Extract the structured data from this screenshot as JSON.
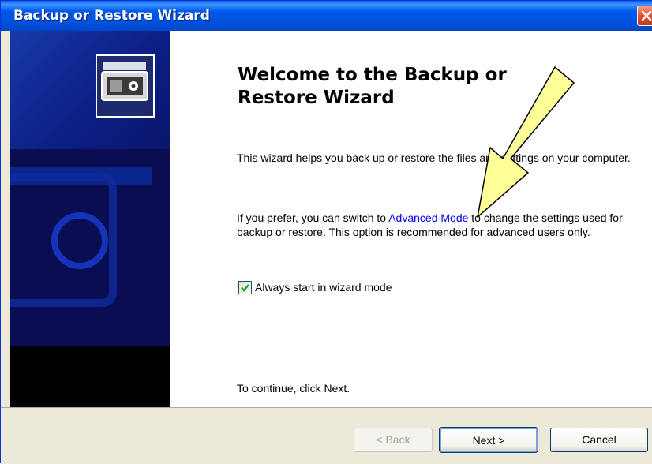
{
  "window": {
    "title": "Backup or Restore Wizard"
  },
  "content": {
    "heading": "Welcome to the Backup or Restore Wizard",
    "intro": "This wizard helps you back up or restore the files and settings on your computer.",
    "advanced_prefix": "If you prefer, you can switch to ",
    "advanced_link": "Advanced Mode",
    "advanced_suffix": " to change the settings used for backup or restore. This option is recommended for advanced users only.",
    "checkbox_label": "Always start in wizard mode",
    "checkbox_checked": true,
    "continue_text": "To continue, click Next."
  },
  "footer": {
    "back_label": "< Back",
    "next_label": "Next >",
    "cancel_label": "Cancel"
  },
  "colors": {
    "titlebar": "#0058ee",
    "sidebar": "#0a0d52",
    "arrow_fill": "#ffff99",
    "link": "#0000ff"
  },
  "icons": {
    "close": "close-icon",
    "wizard": "backup-wizard-icon",
    "check": "checkmark-icon",
    "annotation": "arrow-annotation-icon"
  }
}
